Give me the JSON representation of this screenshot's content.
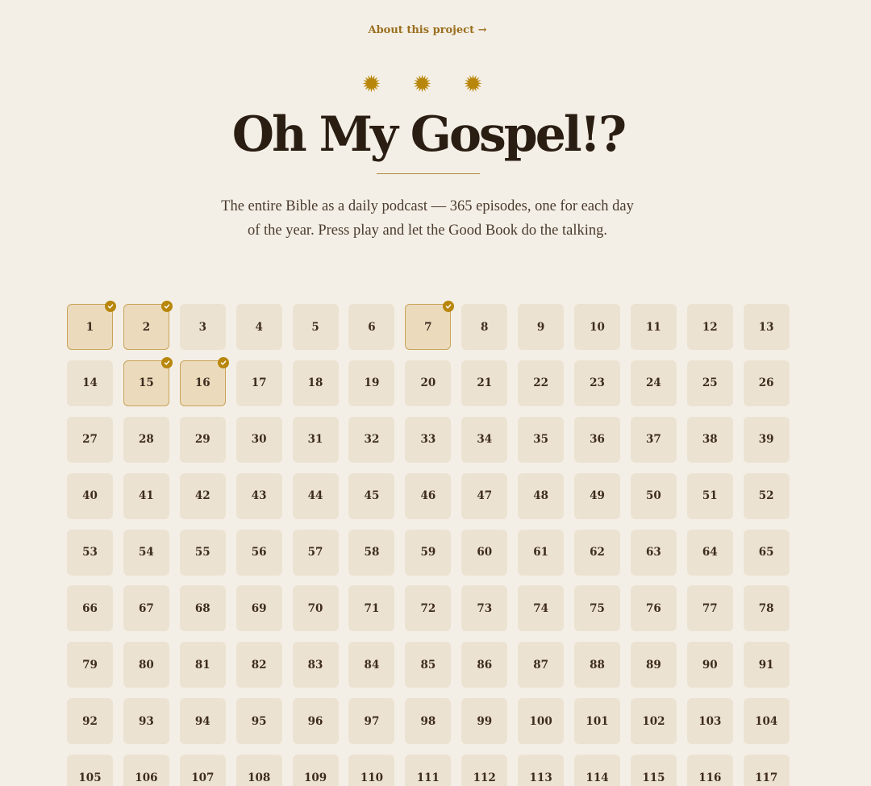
{
  "header": {
    "about_label": "About this project →",
    "star_icon": "eight-point-star-icon",
    "star_color": "#b8860b",
    "title": "Oh My Gospel!?",
    "tagline": "The entire Bible as a daily podcast — 365 episodes, one for each day of the year. Press play and let the Good Book do the talking."
  },
  "episodes": {
    "total": 365,
    "visible_numbers": [
      1,
      2,
      3,
      4,
      5,
      6,
      7,
      8,
      9,
      10,
      11,
      12,
      13,
      14,
      15,
      16,
      17,
      18,
      19,
      20,
      21,
      22,
      23,
      24,
      25,
      26,
      27,
      28,
      29,
      30,
      31,
      32,
      33,
      34,
      35,
      36,
      37,
      38,
      39,
      40,
      41,
      42,
      43,
      44,
      45,
      46,
      47,
      48,
      49,
      50,
      51,
      52,
      53,
      54,
      55,
      56,
      57,
      58,
      59,
      60,
      61,
      62,
      63,
      64,
      65,
      66,
      67,
      68,
      69,
      70,
      71,
      72,
      73,
      74,
      75,
      76,
      77,
      78,
      79,
      80,
      81,
      82,
      83,
      84,
      85,
      86,
      87,
      88,
      89,
      90,
      91,
      92,
      93,
      94,
      95,
      96,
      97,
      98,
      99,
      100,
      101,
      102,
      103,
      104,
      105,
      106,
      107,
      108,
      109,
      110,
      111,
      112,
      113,
      114,
      115,
      116,
      117
    ],
    "completed": [
      1,
      2,
      7,
      15,
      16
    ],
    "completed_icon": "checkmark-icon",
    "accent_color": "#b8860b"
  }
}
